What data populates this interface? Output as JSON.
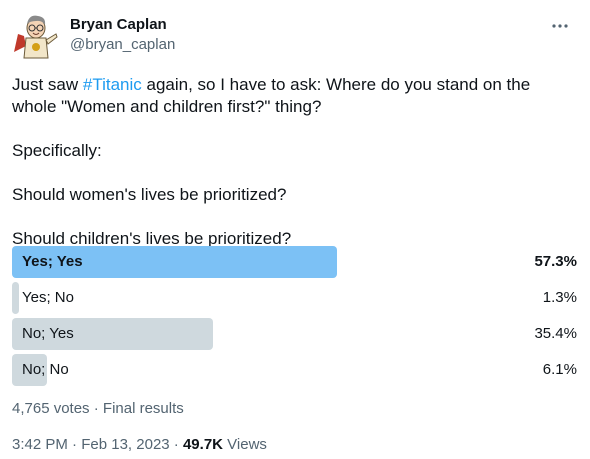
{
  "author": {
    "display_name": "Bryan Caplan",
    "handle": "@bryan_caplan",
    "avatar_icon": "cartoon-avatar-icon"
  },
  "more_icon": "more-dots-icon",
  "tweet": {
    "line1_before": "Just saw ",
    "hashtag": "#Titanic",
    "line1_after": " again, so I have to ask: Where do you stand on the whole \"Women and children first?\" thing?",
    "line2": "Specifically:",
    "line3": "Should women's lives be prioritized?",
    "line4": "Should children's lives be prioritized?"
  },
  "poll": {
    "options": [
      {
        "label": "Yes; Yes",
        "percent_text": "57.3%",
        "percent": 57.3,
        "winner": true
      },
      {
        "label": "Yes; No",
        "percent_text": "1.3%",
        "percent": 1.3,
        "winner": false
      },
      {
        "label": "No; Yes",
        "percent_text": "35.4%",
        "percent": 35.4,
        "winner": false
      },
      {
        "label": "No; No",
        "percent_text": "6.1%",
        "percent": 6.1,
        "winner": false
      }
    ],
    "votes": "4,765 votes",
    "separator": "·",
    "status": "Final results"
  },
  "footer": {
    "time": "3:42 PM",
    "separator1": "·",
    "date": "Feb 13, 2023",
    "separator2": "·",
    "views_count": "49.7K",
    "views_label": "Views"
  },
  "colors": {
    "winner_bar": "#7cc1f5",
    "bar": "#cfd9de",
    "link": "#1d9bf0",
    "secondary_text": "#536471"
  }
}
